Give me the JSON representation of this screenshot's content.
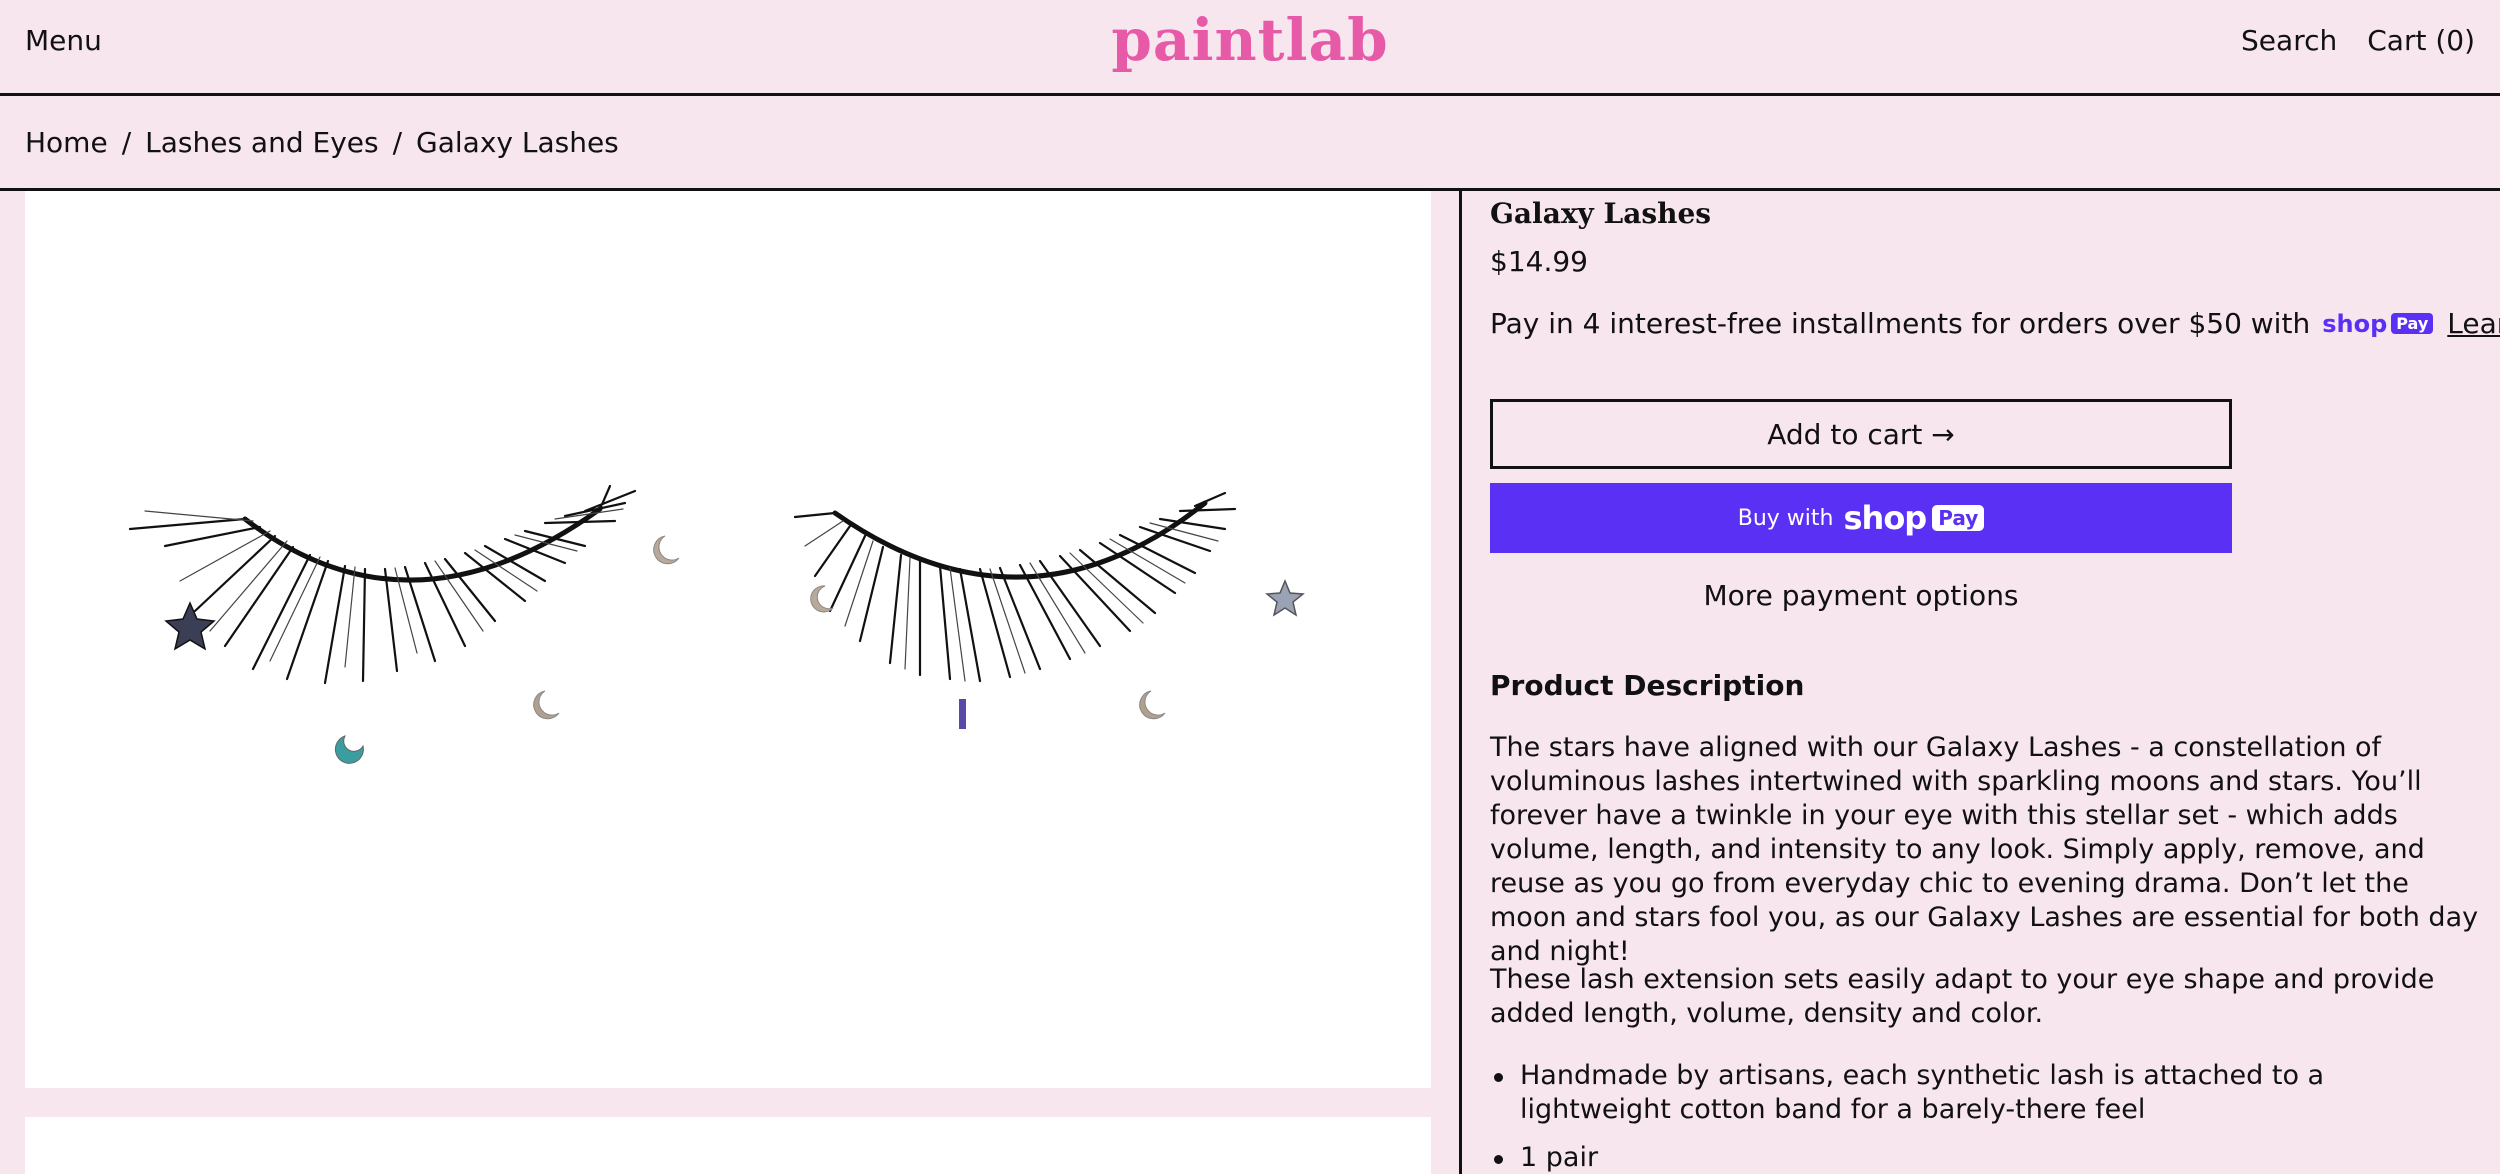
{
  "header": {
    "menu_label": "Menu",
    "logo_text": "paintlab",
    "search_label": "Search",
    "cart_label": "Cart (0)"
  },
  "breadcrumb": {
    "items": [
      "Home",
      "Lashes and Eyes",
      "Galaxy Lashes"
    ],
    "separator": "/"
  },
  "product": {
    "title": "Galaxy Lashes",
    "price": "$14.99",
    "installments_text": "Pay in 4 interest-free installments for orders over $50 with",
    "shoppay_badge_shop": "shop",
    "shoppay_badge_pay": "Pay",
    "learn_more": "Learn more",
    "add_to_cart": "Add to cart →",
    "buy_with_label": "Buy with",
    "buy_shop": "shop",
    "buy_pay": "Pay",
    "more_payment": "More payment options",
    "description_heading": "Product Description",
    "description_p1": "The stars have aligned with our Galaxy Lashes - a constellation of voluminous lashes intertwined with sparkling moons and stars. You’ll forever have a twinkle in your eye with this stellar set - which adds volume, length, and intensity to any look. Simply apply, remove, and reuse as you go from everyday chic to evening drama. Don’t let the moon and stars fool you, as our Galaxy Lashes are essential for both day and night!",
    "description_p2": "These lash extension sets easily adapt to your eye shape and provide added length, volume, density and color.",
    "bullets": [
      "Handmade by artisans, each synthetic lash is attached to a lightweight cotton band for a barely-there feel",
      "1 pair"
    ]
  },
  "colors": {
    "background": "#f8e6ee",
    "logo": "#e65aa8",
    "shoppay": "#5a31f4",
    "text": "#111111"
  },
  "icons": {
    "arrow": "arrow-right-icon"
  }
}
